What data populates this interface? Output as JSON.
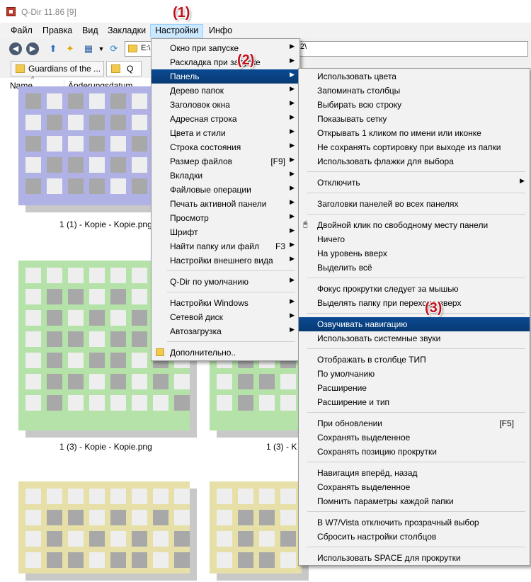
{
  "window": {
    "title": "Q-Dir 11.86 [9]"
  },
  "menubar": {
    "items": [
      "Файл",
      "Правка",
      "Вид",
      "Закладки",
      "Настройки",
      "Инфо"
    ]
  },
  "toolbar": {
    "address_start": "E:\\",
    "address_end": "2\\"
  },
  "tabs": [
    {
      "label": "Guardians of the ...",
      "close": "×"
    },
    {
      "label": "Q"
    }
  ],
  "columns": {
    "name": "Name",
    "date": "Änderungsdatum"
  },
  "files": [
    {
      "caption": "1 (1) - Kopie - Kopie.png",
      "color": "#b0b2e6"
    },
    {
      "caption": "1 (3) - Kopie - Kopie.png",
      "color": "#b5e2a8"
    },
    {
      "caption": "1 (3) - K",
      "color": "#b5e2a8"
    },
    {
      "caption": "",
      "color": "#e6e0a8"
    },
    {
      "caption": "",
      "color": "#e6e0a8"
    }
  ],
  "settings_menu": {
    "items": [
      {
        "label": "Окно при запуске",
        "arrow": "▶"
      },
      {
        "label": "Раскладка при запуске",
        "arrow": "▶"
      },
      {
        "label": "Панель",
        "arrow": "▶",
        "highlighted": true
      },
      {
        "label": "Дерево папок",
        "arrow": "▶"
      },
      {
        "label": "Заголовок окна",
        "arrow": "▶"
      },
      {
        "label": "Адресная строка",
        "arrow": "▶"
      },
      {
        "label": "Цвета и стили",
        "arrow": "▶"
      },
      {
        "label": "Строка состояния",
        "arrow": "▶"
      },
      {
        "label": "Размер файлов",
        "shortcut": "[F9]",
        "arrow": "▶"
      },
      {
        "label": "Вкладки",
        "arrow": "▶"
      },
      {
        "label": "Файловые операции",
        "arrow": "▶"
      },
      {
        "label": "Печать активной панели",
        "arrow": "▶"
      },
      {
        "label": "Просмотр",
        "arrow": "▶"
      },
      {
        "label": "Шрифт",
        "arrow": "▶"
      },
      {
        "label": "Найти папку или файл",
        "shortcut": "F3",
        "arrow": "▶"
      },
      {
        "label": "Настройки внешнего вида",
        "arrow": "▶"
      },
      {
        "label": "Q-Dir по умолчанию",
        "arrow": "▶"
      },
      {
        "label": "Настройки Windows",
        "arrow": "▶"
      },
      {
        "label": "Сетевой диск",
        "arrow": "▶"
      },
      {
        "label": "Автозагрузка",
        "arrow": "▶"
      },
      {
        "label": "Дополнительно.."
      }
    ]
  },
  "panel_submenu": {
    "items": [
      {
        "label": "Использовать цвета"
      },
      {
        "label": "Запоминать столбцы"
      },
      {
        "label": "Выбирать всю строку"
      },
      {
        "label": "Показывать сетку"
      },
      {
        "label": "Открывать 1 кликом по имени или иконке"
      },
      {
        "label": "Не сохранять сортировку при выходе из папки"
      },
      {
        "label": "Использовать флажки для выбора"
      },
      {
        "label": "Отключить",
        "arrow": "▶"
      },
      {
        "label": "Заголовки панелей во всех панелях"
      },
      {
        "label": "Двойной клик по свободному месту панели"
      },
      {
        "label": "Ничего"
      },
      {
        "label": "На уровень вверх"
      },
      {
        "label": "Выделить всё"
      },
      {
        "label": "Фокус прокрутки следует за мышью"
      },
      {
        "label": "Выделять папку при переходе вверх"
      },
      {
        "label": "Озвучивать навигацию",
        "highlighted": true
      },
      {
        "label": "Использовать системные звуки"
      },
      {
        "label": "Отображать в столбце ТИП"
      },
      {
        "label": "По умолчанию"
      },
      {
        "label": "Расширение"
      },
      {
        "label": "Расширение и тип"
      },
      {
        "label": "При обновлении",
        "shortcut": "[F5]"
      },
      {
        "label": "Сохранять выделенное"
      },
      {
        "label": "Сохранять позицию прокрутки"
      },
      {
        "label": "Навигация вперёд, назад"
      },
      {
        "label": "Сохранять выделенное"
      },
      {
        "label": "Помнить параметры каждой папки"
      },
      {
        "label": "В W7/Vista отключить прозрачный выбор"
      },
      {
        "label": "Сбросить настройки столбцов"
      },
      {
        "label": "Использовать SPACE для прокрутки"
      }
    ]
  },
  "annotations": [
    "(1)",
    "(2)",
    "(3)"
  ]
}
